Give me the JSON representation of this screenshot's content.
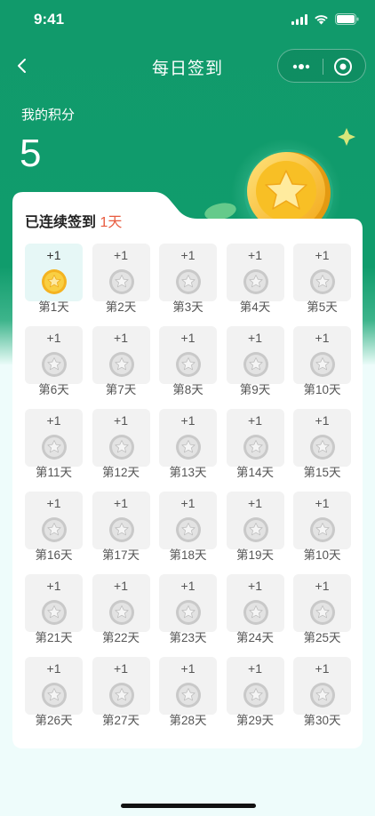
{
  "status_bar": {
    "time": "9:41"
  },
  "nav": {
    "title": "每日签到"
  },
  "points": {
    "label": "我的积分",
    "value": "5"
  },
  "streak": {
    "prefix": "已连续签到 ",
    "days": "1天"
  },
  "days": [
    {
      "reward": "+1",
      "label": "第1天",
      "signed": true
    },
    {
      "reward": "+1",
      "label": "第2天",
      "signed": false
    },
    {
      "reward": "+1",
      "label": "第3天",
      "signed": false
    },
    {
      "reward": "+1",
      "label": "第4天",
      "signed": false
    },
    {
      "reward": "+1",
      "label": "第5天",
      "signed": false
    },
    {
      "reward": "+1",
      "label": "第6天",
      "signed": false
    },
    {
      "reward": "+1",
      "label": "第7天",
      "signed": false
    },
    {
      "reward": "+1",
      "label": "第8天",
      "signed": false
    },
    {
      "reward": "+1",
      "label": "第9天",
      "signed": false
    },
    {
      "reward": "+1",
      "label": "第10天",
      "signed": false
    },
    {
      "reward": "+1",
      "label": "第11天",
      "signed": false
    },
    {
      "reward": "+1",
      "label": "第12天",
      "signed": false
    },
    {
      "reward": "+1",
      "label": "第13天",
      "signed": false
    },
    {
      "reward": "+1",
      "label": "第14天",
      "signed": false
    },
    {
      "reward": "+1",
      "label": "第15天",
      "signed": false
    },
    {
      "reward": "+1",
      "label": "第16天",
      "signed": false
    },
    {
      "reward": "+1",
      "label": "第17天",
      "signed": false
    },
    {
      "reward": "+1",
      "label": "第18天",
      "signed": false
    },
    {
      "reward": "+1",
      "label": "第19天",
      "signed": false
    },
    {
      "reward": "+1",
      "label": "第10天",
      "signed": false
    },
    {
      "reward": "+1",
      "label": "第21天",
      "signed": false
    },
    {
      "reward": "+1",
      "label": "第22天",
      "signed": false
    },
    {
      "reward": "+1",
      "label": "第23天",
      "signed": false
    },
    {
      "reward": "+1",
      "label": "第24天",
      "signed": false
    },
    {
      "reward": "+1",
      "label": "第25天",
      "signed": false
    },
    {
      "reward": "+1",
      "label": "第26天",
      "signed": false
    },
    {
      "reward": "+1",
      "label": "第27天",
      "signed": false
    },
    {
      "reward": "+1",
      "label": "第28天",
      "signed": false
    },
    {
      "reward": "+1",
      "label": "第29天",
      "signed": false
    },
    {
      "reward": "+1",
      "label": "第30天",
      "signed": false
    }
  ],
  "colors": {
    "header_green": "#119a6b",
    "streak_highlight": "#e85b3f",
    "signed_day_bg": "#e6f7f6",
    "day_bg": "#f2f2f2",
    "gold_coin": "#f7c52c",
    "silver_coin": "#cfcfcf"
  },
  "icons": {
    "back": "chevron-left-icon",
    "more": "more-dots-icon",
    "close": "target-circle-icon",
    "sparkle": "sparkle-icon",
    "coin_gold": "star-coin-gold-icon",
    "coin_silver": "star-coin-silver-icon"
  }
}
